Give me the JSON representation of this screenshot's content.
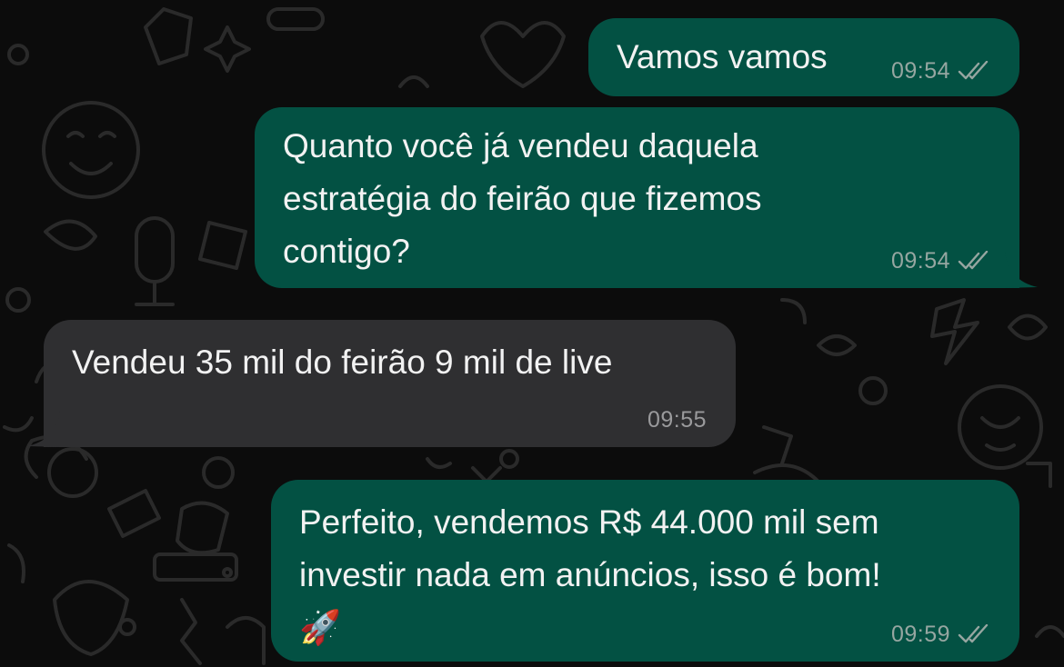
{
  "colors": {
    "outgoing_bubble": "#035143",
    "incoming_bubble": "#2f2f31",
    "background": "#0c0c0c",
    "text": "#f2f2f2",
    "time_outgoing": "#96a6a1",
    "time_incoming": "#9a9a9c"
  },
  "messages": [
    {
      "direction": "outgoing",
      "text": "Vamos vamos",
      "time": "09:54",
      "status": "read-double-check-icon"
    },
    {
      "direction": "outgoing",
      "text": "Quanto você já vendeu daquela\nestratégia do feirão que fizemos\ncontigo?",
      "time": "09:54",
      "status": "read-double-check-icon"
    },
    {
      "direction": "incoming",
      "text": "Vendeu 35 mil do feirão 9 mil de live",
      "time": "09:55"
    },
    {
      "direction": "outgoing",
      "text": "Perfeito, vendemos R$ 44.000 mil sem\ninvestir nada em anúncios, isso é bom!\n🚀",
      "time": "09:59",
      "status": "read-double-check-icon"
    }
  ]
}
